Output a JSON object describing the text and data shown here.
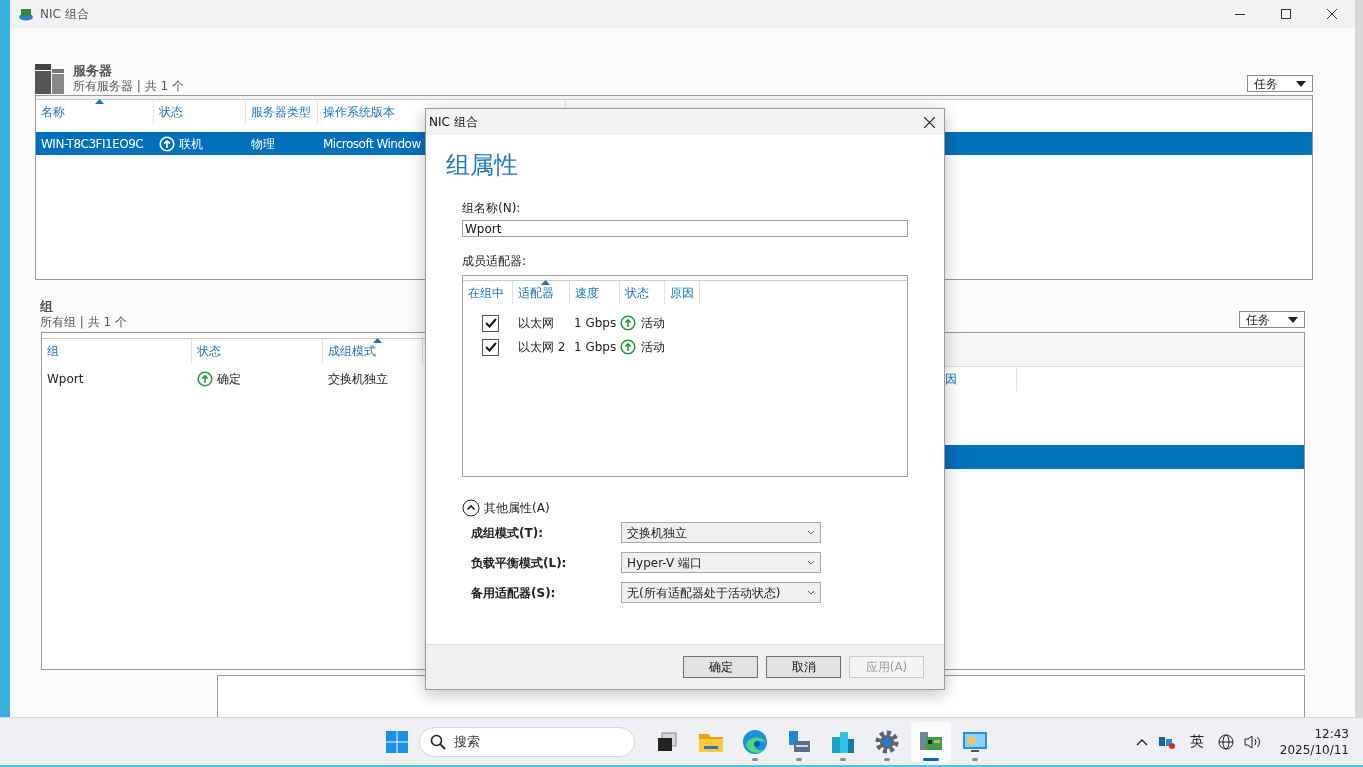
{
  "window": {
    "title": "NIC 组合"
  },
  "servers": {
    "title": "服务器",
    "subtitle": "所有服务器 | 共 1 个",
    "tasks_button": "任务",
    "columns": [
      {
        "label": "名称",
        "sorted": true
      },
      {
        "label": "状态",
        "sorted": false
      },
      {
        "label": "服务器类型",
        "sorted": false
      },
      {
        "label": "操作系统版本",
        "sorted": false
      }
    ],
    "rows": [
      {
        "cells": [
          "WIN-T8C3FI1EO9C",
          "联机",
          "物理",
          "Microsoft Window"
        ],
        "selected": true
      }
    ]
  },
  "groups": {
    "title": "组",
    "subtitle": "所有组 | 共 1 个",
    "tasks_button": "任务",
    "columns": [
      {
        "label": "组",
        "sorted": false
      },
      {
        "label": "状态",
        "sorted": false
      },
      {
        "label": "成组模式",
        "sorted": true
      }
    ],
    "rows": [
      {
        "cells": [
          "Wport",
          "确定",
          "交换机独立"
        ],
        "selected": false
      }
    ]
  },
  "adapters_panel": {
    "column_header": "因",
    "rows": [
      {
        "selected": true
      }
    ]
  },
  "dialog": {
    "title": "NIC 组合",
    "heading": "组属性",
    "name_label": "组名称(N):",
    "name_value": "Wport",
    "members_label": "成员适配器:",
    "member_columns": [
      {
        "label": "在组中",
        "sorted": false
      },
      {
        "label": "适配器",
        "sorted": true
      },
      {
        "label": "速度",
        "sorted": false
      },
      {
        "label": "状态",
        "sorted": false
      },
      {
        "label": "原因",
        "sorted": false
      }
    ],
    "members": [
      {
        "in_team": true,
        "adapter": "以太网",
        "speed": "1 Gbps",
        "status": "活动"
      },
      {
        "in_team": true,
        "adapter": "以太网 2",
        "speed": "1 Gbps",
        "status": "活动"
      }
    ],
    "more": {
      "label": "其他属性(A)",
      "expanded": true
    },
    "properties": [
      {
        "label": "成组模式(T):",
        "value": "交换机独立"
      },
      {
        "label": "负载平衡模式(L):",
        "value": "Hyper-V 端口"
      },
      {
        "label": "备用适配器(S):",
        "value": "无(所有适配器处于活动状态)"
      }
    ],
    "buttons": [
      {
        "label": "确定",
        "disabled": false
      },
      {
        "label": "取消",
        "disabled": false
      },
      {
        "label": "应用(A)",
        "disabled": true
      }
    ]
  },
  "taskbar": {
    "search_placeholder": "搜索",
    "apps": [
      {
        "kind": "taskview",
        "running": false,
        "active": false
      },
      {
        "kind": "folder",
        "running": false,
        "active": false
      },
      {
        "kind": "browser",
        "running": true,
        "active": false
      },
      {
        "kind": "server",
        "running": true,
        "active": false
      },
      {
        "kind": "buildings",
        "running": true,
        "active": false
      },
      {
        "kind": "gear",
        "running": true,
        "active": false
      },
      {
        "kind": "nic",
        "running": true,
        "active": true
      },
      {
        "kind": "remote",
        "running": true,
        "active": false
      }
    ],
    "ime": "英",
    "time": "12:43",
    "date": "2025/10/11"
  }
}
